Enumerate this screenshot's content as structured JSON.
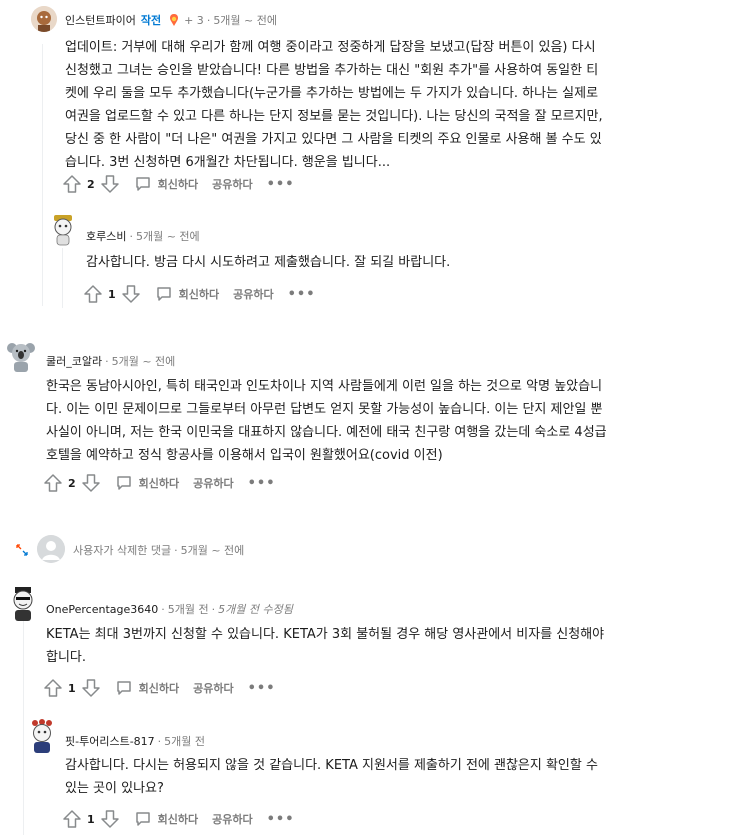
{
  "comments": [
    {
      "username": "인스턴트파이어",
      "op_badge": "작전",
      "awards": "+ 3",
      "time": "5개월 ~ 전에",
      "lines": [
        "업데이트: 거부에 대해 우리가 함께 여행 중이라고 정중하게 답장을 보냈고(답장 버튼이 있음) 다시",
        "신청했고 그녀는 승인을 받았습니다! 다른 방법을 추가하는 대신 \"회원 추가\"를 사용하여 동일한 티",
        "켓에 우리 둘을 모두 추가했습니다(누군가를 추가하는 방법에는 두 가지가 있습니다. 하나는 실제로",
        "여권을 업로드할 수 있고 다른 하나는 단지 정보를 묻는 것입니다). 나는 당신의 국적을 잘 모르지만,",
        "당신 중 한 사람이 \"더 나은\" 여권을 가지고 있다면 그 사람을 티켓의 주요 인물로 사용해 볼 수도 있",
        "습니다. 3번 신청하면 6개월간 차단됩니다. 행운을 빕니다..."
      ],
      "votes": "2",
      "reply": "회신하다",
      "share": "공유하다",
      "more": "•••"
    },
    {
      "username": "호루스비",
      "time": "5개월 ~ 전에",
      "lines": [
        "감사합니다. 방금 다시 시도하려고 제출했습니다. 잘 되길 바랍니다."
      ],
      "votes": "1",
      "reply": "회신하다",
      "share": "공유하다",
      "more": "•••"
    },
    {
      "username": "쿨러_코알라",
      "time": "5개월 ~ 전에",
      "lines": [
        "한국은 동남아시아인, 특히 태국인과 인도차이나 지역 사람들에게 이런 일을 하는 것으로 악명 높았습니",
        "다. 이는 이민 문제이므로 그들로부터 아무런 답변도 얻지 못할 가능성이 높습니다. 이는 단지 제안일 뿐",
        "사실이 아니며, 저는 한국 이민국을 대표하지 않습니다. 예전에 태국 친구랑 여행을 갔는데 숙소로 4성급",
        "호텔을 예약하고 정식 항공사를 이용해서 입국이 원활했어요(covid 이전)"
      ],
      "votes": "2",
      "reply": "회신하다",
      "share": "공유하다",
      "more": "•••"
    },
    {
      "deleted_label": "사용자가 삭제한 댓글",
      "time": "5개월 ~ 전에"
    },
    {
      "username": "OnePercentage3640",
      "time": "5개월 전",
      "edited": "5개월 전 수정됨",
      "lines": [
        "KETA는 최대 3번까지 신청할 수 있습니다. KETA가 3회 불허될 경우 해당 영사관에서 비자를 신청해야",
        "합니다."
      ],
      "votes": "1",
      "reply": "회신하다",
      "share": "공유하다",
      "more": "•••"
    },
    {
      "username": "핏-투어리스트-817",
      "time": "5개월 전",
      "lines": [
        "감사합니다. 다시는 허용되지 않을 것 같습니다. KETA 지원서를 제출하기 전에 괜찮은지 확인할 수",
        "있는 곳이 있나요?"
      ],
      "votes": "1",
      "reply": "회신하다",
      "share": "공유하다",
      "more": "•••"
    }
  ]
}
